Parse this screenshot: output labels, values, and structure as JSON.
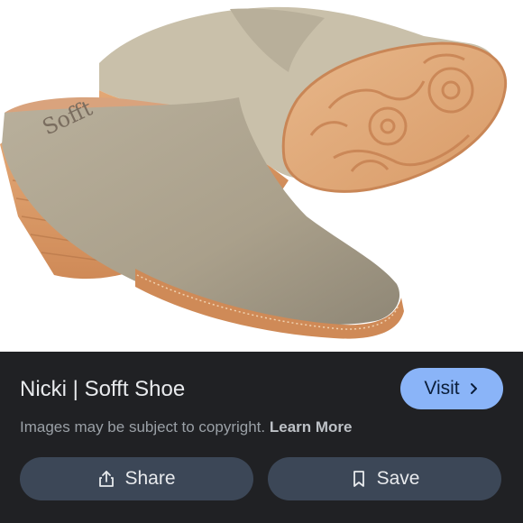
{
  "image": {
    "brand_logo_text": "Sofft"
  },
  "result": {
    "title": "Nicki | Sofft Shoe",
    "visit_label": "Visit",
    "copyright_notice": "Images may be subject to copyright.",
    "learn_more_label": "Learn More"
  },
  "actions": {
    "share_label": "Share",
    "save_label": "Save"
  },
  "icons": {
    "visit": "chevron-right-icon",
    "share": "share-icon",
    "save": "bookmark-icon"
  },
  "colors": {
    "panel_background": "#202124",
    "visit_button": "#8ab4f8",
    "action_button": "#3c4757",
    "title_text": "#e8eaed",
    "secondary_text": "#9aa0a6"
  }
}
